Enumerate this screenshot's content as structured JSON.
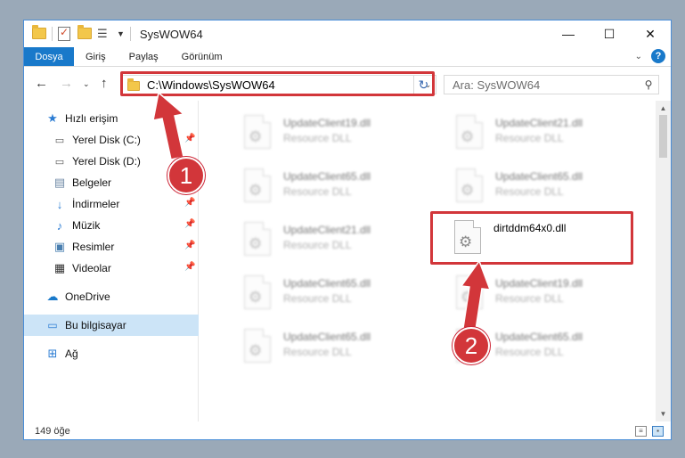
{
  "window": {
    "title": "SysWOW64"
  },
  "ribbon": {
    "tabs": [
      "Dosya",
      "Giriş",
      "Paylaş",
      "Görünüm"
    ]
  },
  "address": {
    "path": "C:\\Windows\\SysWOW64"
  },
  "search": {
    "placeholder": "Ara: SysWOW64"
  },
  "nav": {
    "items": [
      {
        "label": "Hızlı erişim",
        "icon": "star-icon"
      },
      {
        "label": "Yerel Disk (C:)",
        "icon": "drive-icon"
      },
      {
        "label": "Yerel Disk (D:)",
        "icon": "drive-icon"
      },
      {
        "label": "Belgeler",
        "icon": "document-icon"
      },
      {
        "label": "İndirmeler",
        "icon": "download-icon"
      },
      {
        "label": "Müzik",
        "icon": "music-icon"
      },
      {
        "label": "Resimler",
        "icon": "picture-icon"
      },
      {
        "label": "Videolar",
        "icon": "video-icon"
      },
      {
        "label": "OneDrive",
        "icon": "cloud-icon"
      },
      {
        "label": "Bu bilgisayar",
        "icon": "computer-icon"
      },
      {
        "label": "Ağ",
        "icon": "network-icon"
      }
    ]
  },
  "files": [
    {
      "name": "UpdateClient19.dll",
      "desc": "Resource DLL"
    },
    {
      "name": "UpdateClient21.dll",
      "desc": "Resource DLL"
    },
    {
      "name": "UpdateClient65.dll",
      "desc": "Resource DLL"
    },
    {
      "name": "UpdateClient65.dll",
      "desc": "Resource DLL"
    },
    {
      "name": "UpdateClient21.dll",
      "desc": "Resource DLL"
    },
    {
      "name": "dirtddm64x0.dll",
      "desc": ""
    },
    {
      "name": "UpdateClient65.dll",
      "desc": "Resource DLL"
    },
    {
      "name": "UpdateClient19.dll",
      "desc": "Resource DLL"
    },
    {
      "name": "UpdateClient65.dll",
      "desc": "Resource DLL"
    },
    {
      "name": "UpdateClient65.dll",
      "desc": "Resource DLL"
    }
  ],
  "status": {
    "count": "149 öğe"
  },
  "annotations": {
    "step1": "1",
    "step2": "2",
    "color": "#d2363a"
  }
}
